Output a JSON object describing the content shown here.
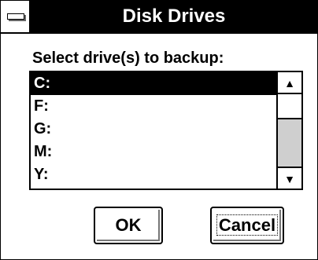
{
  "dialog": {
    "title": "Disk Drives",
    "prompt": "Select drive(s) to backup:",
    "drives": [
      {
        "label": "C:",
        "selected": true
      },
      {
        "label": "F:",
        "selected": false
      },
      {
        "label": "G:",
        "selected": false
      },
      {
        "label": "M:",
        "selected": false
      },
      {
        "label": "Y:",
        "selected": false
      }
    ],
    "scroll_up_glyph": "▲",
    "scroll_down_glyph": "▼",
    "ok_label": "OK",
    "cancel_label": "Cancel"
  }
}
